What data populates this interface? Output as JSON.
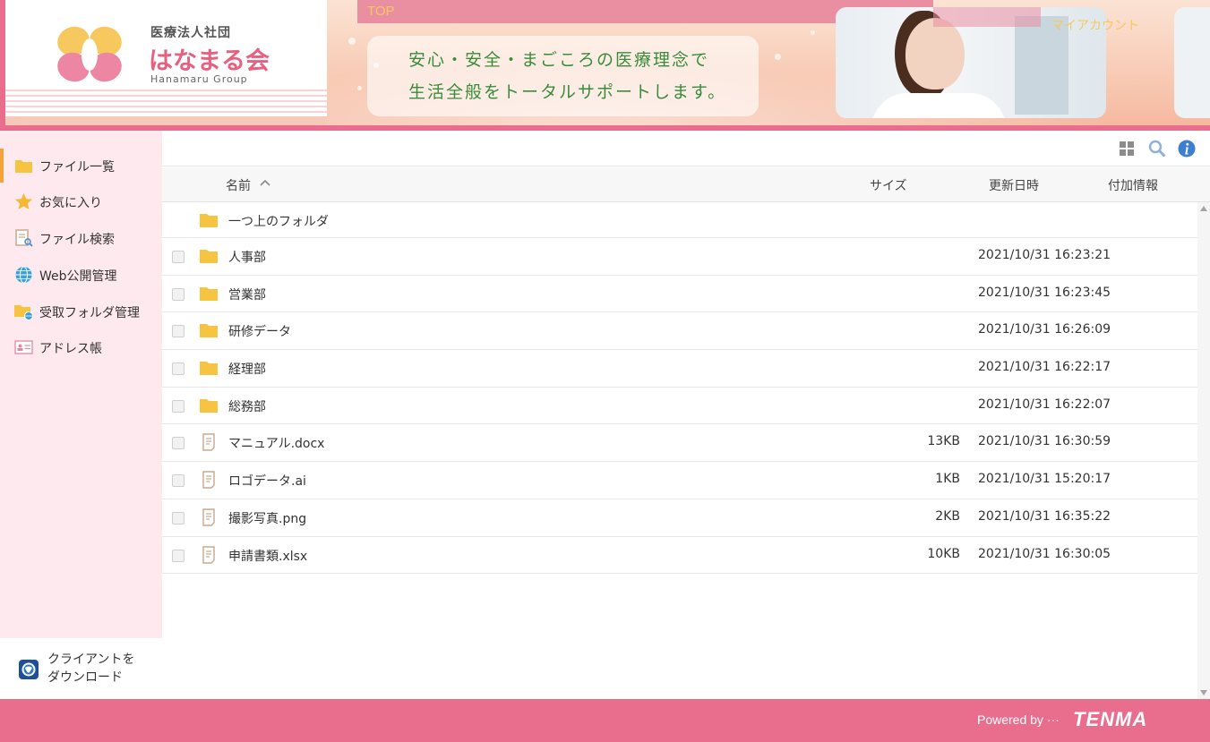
{
  "header": {
    "org_type": "医療法人社団",
    "org_name": "はなまる会",
    "org_name_en": "Hanamaru Group",
    "top_link": "TOP",
    "tagline_line1": "安心・安全・まごころの医療理念で",
    "tagline_line2": "生活全般をトータルサポートします。",
    "my_account": "マイアカウント"
  },
  "sidebar": {
    "items": [
      {
        "label": "ファイル一覧",
        "icon": "folder-icon",
        "active": true
      },
      {
        "label": "お気に入り",
        "icon": "star-icon"
      },
      {
        "label": "ファイル検索",
        "icon": "file-search-icon"
      },
      {
        "label": "Web公開管理",
        "icon": "globe-icon"
      },
      {
        "label": "受取フォルダ管理",
        "icon": "folder-globe-icon"
      },
      {
        "label": "アドレス帳",
        "icon": "address-card-icon"
      }
    ],
    "client_download_line1": "クライアントを",
    "client_download_line2": "ダウンロード"
  },
  "toolbar": {
    "icons": [
      "grid-view-icon",
      "search-icon",
      "info-icon"
    ]
  },
  "list": {
    "columns": {
      "name": "名前",
      "size": "サイズ",
      "modified": "更新日時",
      "extra": "付加情報"
    },
    "parent_folder": "一つ上のフォルダ",
    "rows": [
      {
        "name": "人事部",
        "type": "folder",
        "size": "",
        "date": "2021/10/31 16:23:21"
      },
      {
        "name": "営業部",
        "type": "folder",
        "size": "",
        "date": "2021/10/31 16:23:45"
      },
      {
        "name": "研修データ",
        "type": "folder",
        "size": "",
        "date": "2021/10/31 16:26:09"
      },
      {
        "name": "経理部",
        "type": "folder",
        "size": "",
        "date": "2021/10/31 16:22:17"
      },
      {
        "name": "総務部",
        "type": "folder",
        "size": "",
        "date": "2021/10/31 16:22:07"
      },
      {
        "name": "マニュアル.docx",
        "type": "file",
        "size": "13KB",
        "date": "2021/10/31 16:30:59"
      },
      {
        "name": "ロゴデータ.ai",
        "type": "file",
        "size": "1KB",
        "date": "2021/10/31 15:20:17"
      },
      {
        "name": "撮影写真.png",
        "type": "file",
        "size": "2KB",
        "date": "2021/10/31 16:35:22"
      },
      {
        "name": "申請書類.xlsx",
        "type": "file",
        "size": "10KB",
        "date": "2021/10/31 16:30:05"
      }
    ]
  },
  "footer": {
    "powered_by": "Powered by ···",
    "brand": "TENMA"
  },
  "colors": {
    "accent_pink": "#e96e8d",
    "sidebar_bg": "#fde9ee",
    "folder_yellow": "#f7c441",
    "active_marker": "#f2a33a",
    "tagline_green": "#3a8c3a"
  }
}
